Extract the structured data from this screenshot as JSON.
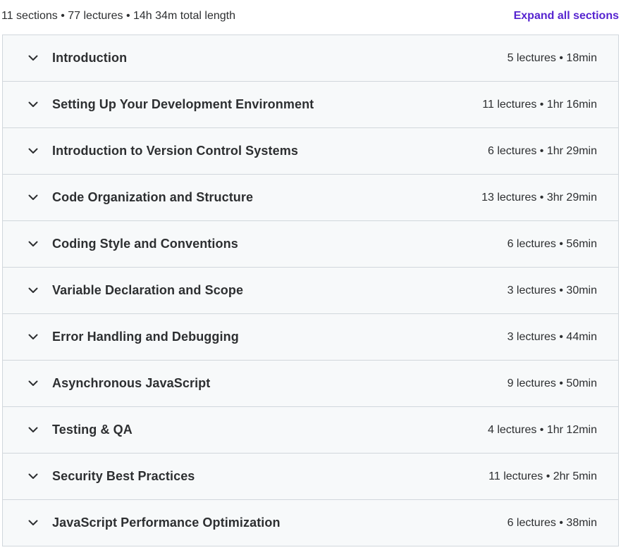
{
  "curriculum": {
    "summary": "11 sections • 77 lectures • 14h 34m total length",
    "expand_all_label": "Expand all sections",
    "accent_color": "#5624d0",
    "toggle_icon": "chevron-down-icon",
    "sections": [
      {
        "title": "Introduction",
        "meta": "5 lectures • 18min"
      },
      {
        "title": "Setting Up Your Development Environment",
        "meta": "11 lectures • 1hr 16min"
      },
      {
        "title": "Introduction to Version Control Systems",
        "meta": "6 lectures • 1hr 29min"
      },
      {
        "title": "Code Organization and Structure",
        "meta": "13 lectures • 3hr 29min"
      },
      {
        "title": "Coding Style and Conventions",
        "meta": "6 lectures • 56min"
      },
      {
        "title": "Variable Declaration and Scope",
        "meta": "3 lectures • 30min"
      },
      {
        "title": "Error Handling and Debugging",
        "meta": "3 lectures • 44min"
      },
      {
        "title": "Asynchronous JavaScript",
        "meta": "9 lectures • 50min"
      },
      {
        "title": "Testing & QA",
        "meta": "4 lectures • 1hr 12min"
      },
      {
        "title": "Security Best Practices",
        "meta": "11 lectures • 2hr 5min"
      },
      {
        "title": "JavaScript Performance Optimization",
        "meta": "6 lectures • 38min"
      }
    ]
  }
}
